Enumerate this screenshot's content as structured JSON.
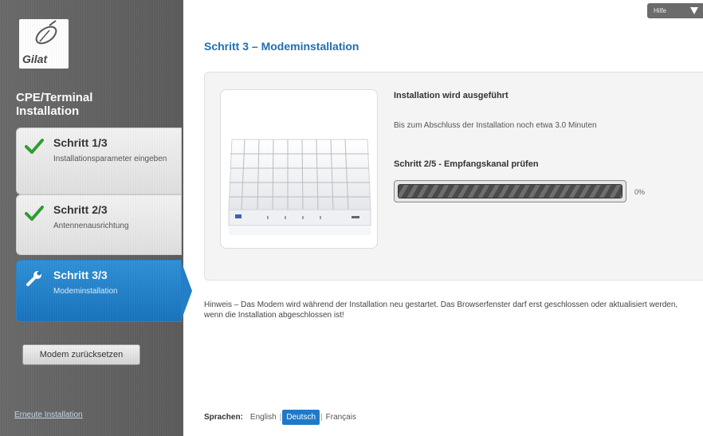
{
  "logo": {
    "brand": "Gilat"
  },
  "app": {
    "title_line1": "CPE/Terminal",
    "title_line2": "Installation"
  },
  "steps": [
    {
      "title": "Schritt 1/3",
      "subtitle": "Installationsparameter eingeben",
      "state": "done"
    },
    {
      "title": "Schritt 2/3",
      "subtitle": "Antennenausrichtung",
      "state": "done"
    },
    {
      "title": "Schritt 3/3",
      "subtitle": "Modeminstallation",
      "state": "active"
    }
  ],
  "sidebar": {
    "reset_label": "Modem zurücksetzen",
    "reinstall_label": "Erneute Installation"
  },
  "header": {
    "help_label": "Hilfe"
  },
  "main": {
    "title": "Schritt 3 – Modeminstallation",
    "install_status": "Installation wird ausgeführt",
    "remaining": "Bis zum Abschluss der Installation noch etwa 3.0 Minuten",
    "current_step": "Schritt 2/5 - Empfangskanal prüfen",
    "progress_percent": "0%",
    "progress_value": 0,
    "hint": "Hinweis – Das Modem wird während der Installation neu gestartet. Das Browserfenster darf erst geschlossen oder aktualisiert werden, wenn die Installation abgeschlossen ist!"
  },
  "languages": {
    "label": "Sprachen:",
    "items": [
      "English",
      "Deutsch",
      "Français"
    ],
    "selected": "Deutsch"
  },
  "colors": {
    "accent": "#1e6fb3",
    "sidebar_bg": "#616161",
    "active_step": "#2585cf",
    "check_green": "#2e9e2e"
  }
}
